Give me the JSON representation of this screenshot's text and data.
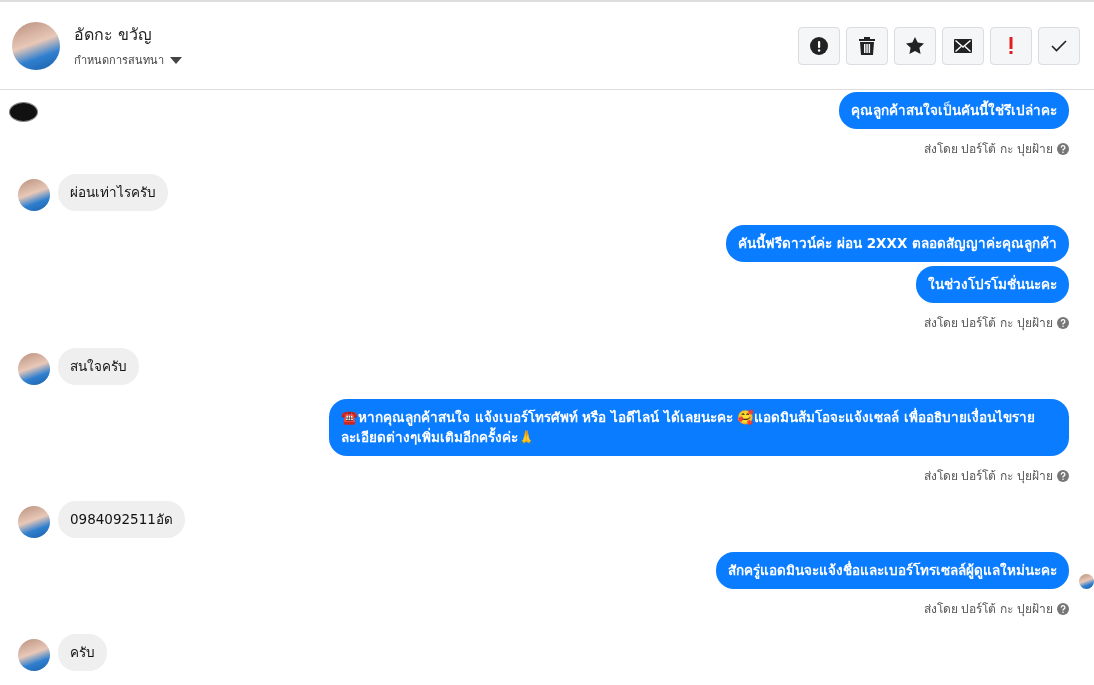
{
  "header": {
    "name": "อัดกะ ขวัญ",
    "subtitle": "กำหนดการสนทนา"
  },
  "toolbar": [
    {
      "kind": "alert"
    },
    {
      "kind": "trash"
    },
    {
      "kind": "star"
    },
    {
      "kind": "mail"
    },
    {
      "kind": "important"
    },
    {
      "kind": "done"
    }
  ],
  "messages": [
    {
      "kind": "out",
      "page_logo": true,
      "seen": false,
      "bubbles": [
        "คุณลูกค้าสนใจเป็นคันนี้ใช่รึเปล่าคะ"
      ],
      "sent_by": "ส่งโดย ปอร์โต้ กะ ปุยฝ้าย"
    },
    {
      "kind": "in",
      "bubbles": [
        "ผ่อนเท่าไรครับ"
      ]
    },
    {
      "kind": "out",
      "page_logo": false,
      "seen": false,
      "bubbles": [
        "คันนี้ฟรีดาวน์ค่ะ ผ่อน 2XXX ตลอดสัญญาค่ะคุณลูกค้า",
        "ในช่วงโปรโมชั่นนะคะ"
      ],
      "sent_by": "ส่งโดย ปอร์โต้ กะ ปุยฝ้าย"
    },
    {
      "kind": "in",
      "bubbles": [
        "สนใจครับ"
      ]
    },
    {
      "kind": "out",
      "page_logo": false,
      "seen": false,
      "bubbles": [
        "☎️หากคุณลูกค้าสนใจ แจ้งเบอร์โทรศัพท์ หรือ ไอดีไลน์  ได้เลยนะคะ 🥰แอดมินส้มโอจะแจ้งเซลล์   เพื่ออธิบายเงื่อนไขรายละเอียดต่างๆเพิ่มเติมอีกครั้งค่ะ🙏"
      ],
      "sent_by": "ส่งโดย ปอร์โต้ กะ ปุยฝ้าย"
    },
    {
      "kind": "in",
      "bubbles": [
        "0984092511อัด"
      ]
    },
    {
      "kind": "out",
      "page_logo": false,
      "seen": true,
      "bubbles": [
        "สักครู่แอดมินจะแจ้งชื่อและเบอร์โทรเซลล์ผู้ดูแลใหม่นะคะ"
      ],
      "sent_by": "ส่งโดย ปอร์โต้ กะ ปุยฝ้าย"
    },
    {
      "kind": "in",
      "bubbles": [
        "ครับ"
      ]
    }
  ]
}
